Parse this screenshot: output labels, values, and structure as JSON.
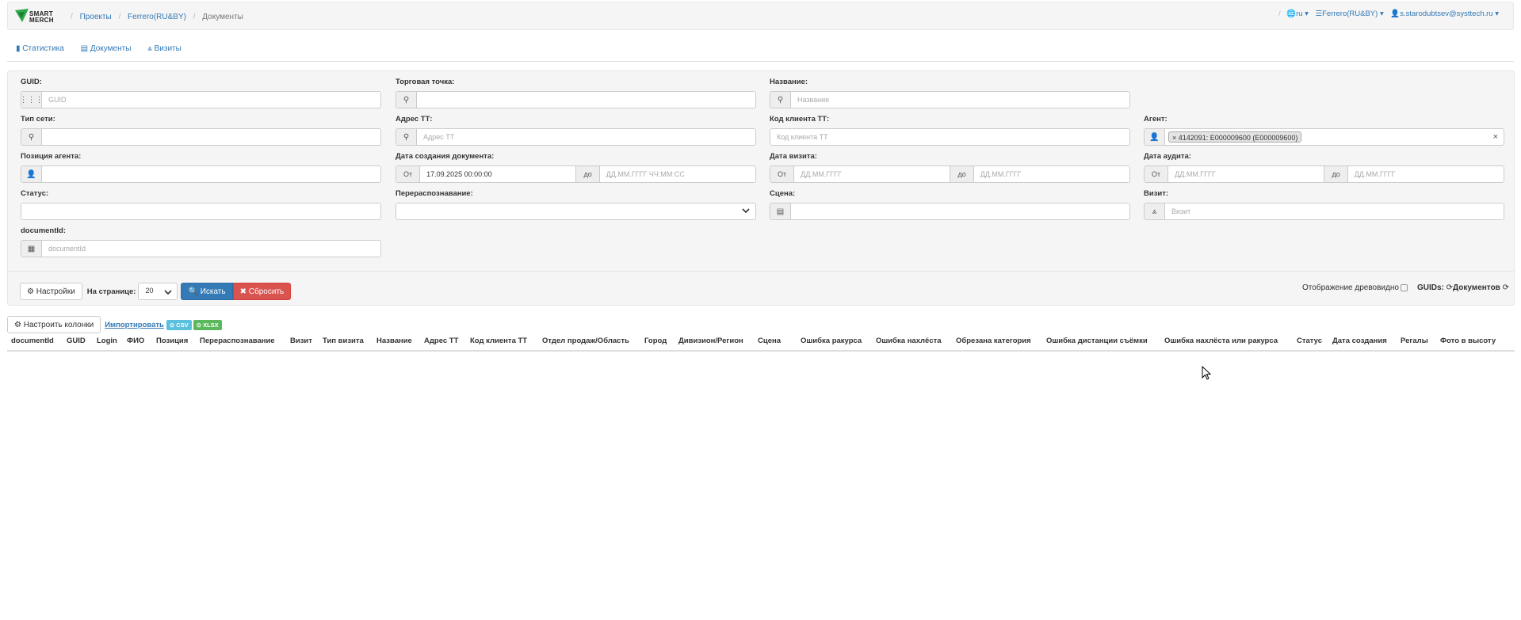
{
  "header": {
    "logo_text": "SMART MERCH",
    "breadcrumbs": [
      "Проекты",
      "Ferrero(RU&BY)",
      "Документы"
    ],
    "lang": "ru",
    "project": "Ferrero(RU&BY)",
    "user": "s.starodubtsev@systtech.ru"
  },
  "tabs": [
    "Статистика",
    "Документы",
    "Визиты"
  ],
  "filters": {
    "guid": {
      "label": "GUID:",
      "placeholder": "GUID"
    },
    "outlet": {
      "label": "Торговая точка:",
      "placeholder": ""
    },
    "name": {
      "label": "Название:",
      "placeholder": "Название"
    },
    "network_type": {
      "label": "Тип сети:",
      "placeholder": ""
    },
    "address": {
      "label": "Адрес ТТ:",
      "placeholder": "Адрес ТТ"
    },
    "client_code": {
      "label": "Код клиента ТТ:",
      "placeholder": "Код клиента ТТ"
    },
    "agent": {
      "label": "Агент:",
      "tag": "× 4142091: E000009600 (E000009600)",
      "clear": "×"
    },
    "agent_position": {
      "label": "Позиция агента:",
      "placeholder": ""
    },
    "doc_created": {
      "label": "Дата создания документа:",
      "from_label": "От",
      "from_value": "17.09.2025 00:00:00",
      "to_label": "до",
      "to_placeholder": "ДД.ММ.ГГГГ ЧЧ:ММ:СС"
    },
    "visit_date": {
      "label": "Дата визита:",
      "from_label": "От",
      "from_placeholder": "ДД.ММ.ГГГГ",
      "to_label": "до",
      "to_placeholder": "ДД.ММ.ГГГГ"
    },
    "audit_date": {
      "label": "Дата аудита:",
      "from_label": "От",
      "from_placeholder": "ДД.ММ.ГГГГ",
      "to_label": "до",
      "to_placeholder": "ДД.ММ.ГГГГ"
    },
    "status": {
      "label": "Статус:",
      "placeholder": ""
    },
    "rerecognition": {
      "label": "Перераспознавание:",
      "value": ""
    },
    "scene": {
      "label": "Сцена:",
      "placeholder": ""
    },
    "visit": {
      "label": "Визит:",
      "placeholder": "Визит"
    },
    "document_id": {
      "label": "documentId:",
      "placeholder": "documentId"
    }
  },
  "actions": {
    "settings": "Настройки",
    "per_page_label": "На странице:",
    "per_page_value": "20",
    "search": "Искать",
    "reset": "Сбросить",
    "tree_view": "Отображение древовидно",
    "guids": "GUIDs:",
    "documents": "Документов"
  },
  "table": {
    "configure_columns": "Настроить колонки",
    "import": "Импортировать",
    "csv": "CSV",
    "xlsx": "XLSX",
    "columns": [
      "documentId",
      "GUID",
      "Login",
      "ФИО",
      "Позиция",
      "Перераспознавание",
      "Визит",
      "Тип визита",
      "Название",
      "Адрес ТТ",
      "Код клиента ТТ",
      "Отдел продаж/Область",
      "Город",
      "Дивизион/Регион",
      "Сцена",
      "Ошибка ракурса",
      "Ошибка нахлёста",
      "Обрезана категория",
      "Ошибка дистанции съёмки",
      "Ошибка нахлёста или ракурса",
      "Статус",
      "Дата создания",
      "Регалы",
      "Фото в высоту"
    ]
  },
  "colors": {
    "link": "#337ab7",
    "primary": "#337ab7",
    "danger": "#d9534f",
    "csv": "#5bc0de",
    "xlsx": "#5cb85c",
    "logo_green": "#2ea84a"
  }
}
